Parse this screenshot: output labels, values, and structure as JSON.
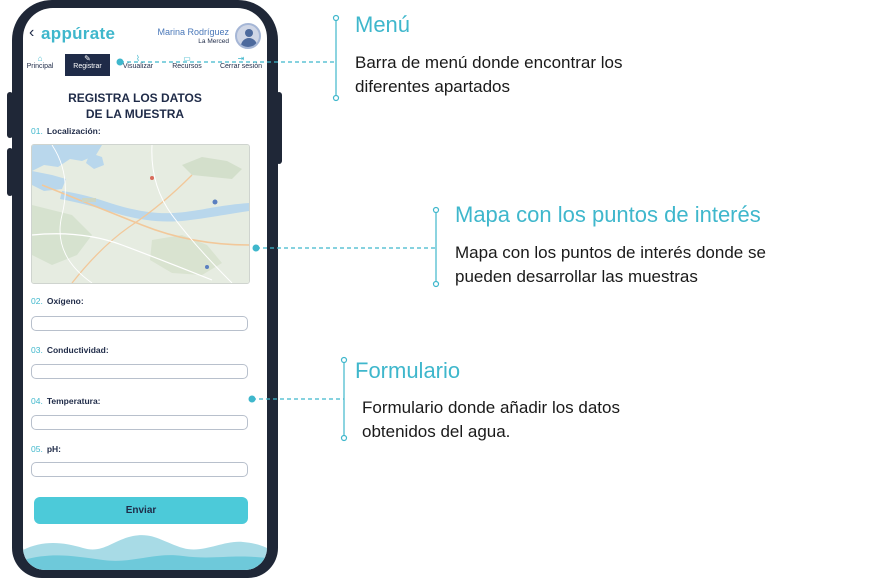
{
  "app": {
    "logo": "appúrate",
    "back_icon": "chevron-left-icon",
    "user_name": "Marina Rodríguez",
    "user_location": "La Merced"
  },
  "nav": {
    "items": [
      {
        "label": "Principal",
        "icon": "home-icon"
      },
      {
        "label": "Registrar",
        "icon": "edit-icon",
        "active": true
      },
      {
        "label": "Visualizar",
        "icon": "chart-icon"
      },
      {
        "label": "Recursos",
        "icon": "book-icon"
      },
      {
        "label": "Cerrar sesión",
        "icon": "logout-icon"
      }
    ]
  },
  "form": {
    "title_line1": "REGISTRA LOS DATOS",
    "title_line2": "DE LA MUESTRA",
    "questions": [
      {
        "num": "01.",
        "label": "Localización:"
      },
      {
        "num": "02.",
        "label": "Oxígeno:"
      },
      {
        "num": "03.",
        "label": "Conductividad:"
      },
      {
        "num": "04.",
        "label": "Temperatura:"
      },
      {
        "num": "05.",
        "label": "pH:"
      }
    ],
    "submit_label": "Enviar"
  },
  "annotations": [
    {
      "title": "Menú",
      "desc_line1": "Barra de menú donde encontrar los",
      "desc_line2": "diferentes apartados"
    },
    {
      "title": "Mapa con los puntos de interés",
      "desc_line1": "Mapa con los puntos de interés donde se",
      "desc_line2": "pueden desarrollar las muestras"
    },
    {
      "title": "Formulario",
      "desc_line1": "Formulario donde añadir los datos",
      "desc_line2": "obtenidos del agua."
    }
  ],
  "colors": {
    "accent": "#3fb7cc",
    "navy": "#1f2b48",
    "button": "#4ccad9",
    "frame": "#1f2737"
  }
}
